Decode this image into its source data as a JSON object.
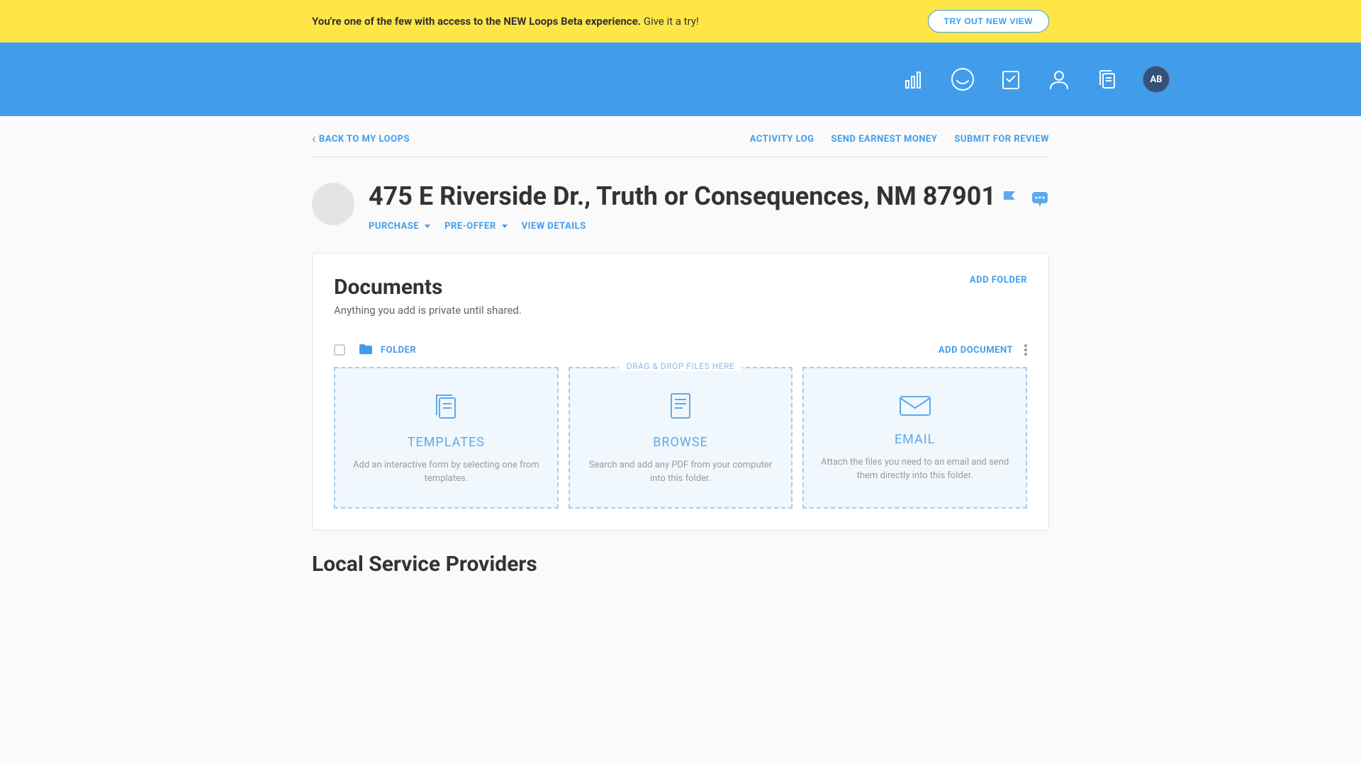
{
  "banner": {
    "text_strong": "You're one of the few with access to the NEW Loops Beta experience.",
    "text_rest": " Give it a try!",
    "button": "TRY OUT NEW VIEW"
  },
  "avatar": {
    "initials": "AB"
  },
  "subnav": {
    "back": "BACK TO MY LOOPS",
    "activity": "ACTIVITY LOG",
    "earnest": "SEND EARNEST MONEY",
    "submit": "SUBMIT FOR REVIEW"
  },
  "header": {
    "title": "475 E Riverside Dr., Truth or Consequences, NM 87901",
    "purchase": "PURCHASE",
    "stage": "PRE-OFFER",
    "details": "VIEW DETAILS"
  },
  "documents": {
    "title": "Documents",
    "sub": "Anything you add is private until shared.",
    "add_folder": "ADD FOLDER",
    "folder_label": "FOLDER",
    "add_doc": "ADD DOCUMENT",
    "drag_label": "DRAG & DROP FILES HERE",
    "cards": {
      "templates_title": "TEMPLATES",
      "templates_desc": "Add an interactive form by selecting one from templates.",
      "browse_title": "BROWSE",
      "browse_desc": "Search and add any PDF from your computer into this folder.",
      "email_title": "EMAIL",
      "email_desc": "Attach the files you need to an email and send them directly into this folder."
    }
  },
  "providers": {
    "title": "Local Service Providers"
  }
}
